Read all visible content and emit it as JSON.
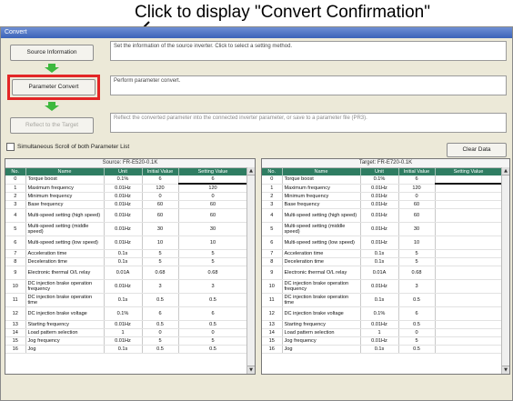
{
  "callout": "Click to display \"Convert Confirmation\"",
  "window": {
    "title": "Convert"
  },
  "steps": {
    "source_info": {
      "label": "Source Information",
      "desc": "Set the information of the source inverter. Click to select a setting method."
    },
    "param_convert": {
      "label": "Parameter Convert",
      "desc": "Perform parameter convert."
    },
    "reflect": {
      "label": "Reflect to the Target",
      "desc": "Reflect the converted parameter into the connected inverter parameter, or save to a parameter file (PR3)."
    }
  },
  "sync_scroll_label": "Simultaneous Scroll of both Parameter List",
  "clear_data_label": "Clear Data",
  "source": {
    "title": "Source: FR-E520-0.1K",
    "headers": [
      "No.",
      "Name",
      "Unit",
      "Initial Value",
      "Setting Value"
    ],
    "rows": [
      [
        "0",
        "Torque boost",
        "0.1%",
        "6",
        "6"
      ],
      [
        "1",
        "Maximum frequency",
        "0.01Hz",
        "120",
        "120"
      ],
      [
        "2",
        "Minimum frequency",
        "0.01Hz",
        "0",
        "0"
      ],
      [
        "3",
        "Base frequency",
        "0.01Hz",
        "60",
        "60"
      ],
      [
        "4",
        "Multi-speed setting (high speed)",
        "0.01Hz",
        "60",
        "60"
      ],
      [
        "5",
        "Multi-speed setting (middle speed)",
        "0.01Hz",
        "30",
        "30"
      ],
      [
        "6",
        "Multi-speed setting (low speed)",
        "0.01Hz",
        "10",
        "10"
      ],
      [
        "7",
        "Acceleration time",
        "0.1s",
        "5",
        "5"
      ],
      [
        "8",
        "Deceleration time",
        "0.1s",
        "5",
        "5"
      ],
      [
        "9",
        "Electronic thermal O/L relay",
        "0.01A",
        "0.68",
        "0.68"
      ],
      [
        "10",
        "DC injection brake operation frequency",
        "0.01Hz",
        "3",
        "3"
      ],
      [
        "11",
        "DC injection brake operation time",
        "0.1s",
        "0.5",
        "0.5"
      ],
      [
        "12",
        "DC injection brake voltage",
        "0.1%",
        "6",
        "6"
      ],
      [
        "13",
        "Starting frequency",
        "0.01Hz",
        "0.5",
        "0.5"
      ],
      [
        "14",
        "Load pattern selection",
        "1",
        "0",
        "0"
      ],
      [
        "15",
        "Jog frequency",
        "0.01Hz",
        "5",
        "5"
      ],
      [
        "16",
        "Jog",
        "0.1s",
        "0.5",
        "0.5"
      ]
    ]
  },
  "target": {
    "title": "Target: FR-E720-0.1K",
    "headers": [
      "No.",
      "Name",
      "Unit",
      "Initial Value",
      "Setting Value"
    ],
    "rows": [
      [
        "0",
        "Torque boost",
        "0.1%",
        "6",
        ""
      ],
      [
        "1",
        "Maximum frequency",
        "0.01Hz",
        "120",
        ""
      ],
      [
        "2",
        "Minimum frequency",
        "0.01Hz",
        "0",
        ""
      ],
      [
        "3",
        "Base frequency",
        "0.01Hz",
        "60",
        ""
      ],
      [
        "4",
        "Multi-speed setting (high speed)",
        "0.01Hz",
        "60",
        ""
      ],
      [
        "5",
        "Multi-speed setting (middle speed)",
        "0.01Hz",
        "30",
        ""
      ],
      [
        "6",
        "Multi-speed setting (low speed)",
        "0.01Hz",
        "10",
        ""
      ],
      [
        "7",
        "Acceleration time",
        "0.1s",
        "5",
        ""
      ],
      [
        "8",
        "Deceleration time",
        "0.1s",
        "5",
        ""
      ],
      [
        "9",
        "Electronic thermal O/L relay",
        "0.01A",
        "0.68",
        ""
      ],
      [
        "10",
        "DC injection brake operation frequency",
        "0.01Hz",
        "3",
        ""
      ],
      [
        "11",
        "DC injection brake operation time",
        "0.1s",
        "0.5",
        ""
      ],
      [
        "12",
        "DC injection brake voltage",
        "0.1%",
        "6",
        ""
      ],
      [
        "13",
        "Starting frequency",
        "0.01Hz",
        "0.5",
        ""
      ],
      [
        "14",
        "Load pattern selection",
        "1",
        "0",
        ""
      ],
      [
        "15",
        "Jog frequency",
        "0.01Hz",
        "5",
        ""
      ],
      [
        "16",
        "Jog",
        "0.1s",
        "0.5",
        ""
      ]
    ]
  },
  "colors": {
    "header_green": "#2f7d62",
    "step_arrow": "#3db83d",
    "highlight": "#e32626"
  },
  "icons": [
    "arrow-down-icon",
    "pointer-arrow-icon",
    "scroll-up-icon",
    "scroll-down-icon"
  ]
}
